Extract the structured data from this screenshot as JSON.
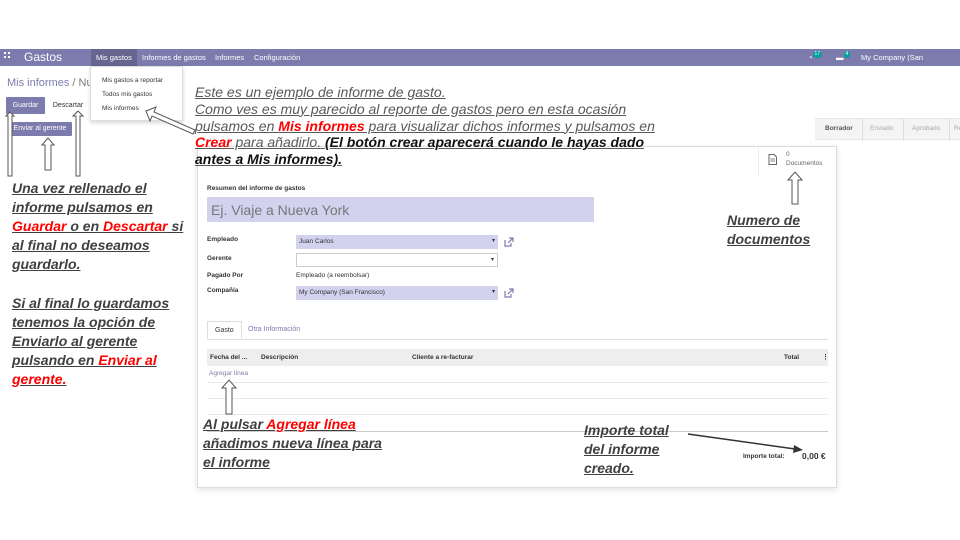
{
  "navbar": {
    "brand": "Gastos",
    "menus": [
      "Mis gastos",
      "Informes de gastos",
      "Informes",
      "Configuración"
    ],
    "activity_count": "17",
    "message_count": "4",
    "company": "My Company (San Francisco)"
  },
  "dropdown": {
    "items": [
      "Mis gastos a reportar",
      "Todos mis gastos",
      "Mis informes"
    ]
  },
  "breadcrumb": {
    "parent": "Mis informes",
    "separator": " / ",
    "current": "Nue"
  },
  "buttons": {
    "save": "Guardar",
    "discard": "Descartar",
    "send_manager": "Enviar al gerente"
  },
  "statusbar": {
    "stages": [
      "Borrador",
      "Enviado",
      "Aprobado",
      "Re"
    ]
  },
  "sheet": {
    "docs_count": "0",
    "docs_label": "Documentos",
    "summary_label": "Resumen del informe de gastos",
    "title_placeholder": "Ej. Viaje a Nueva York",
    "employee_label": "Empleado",
    "employee_value": "Juan Carlos",
    "manager_label": "Gerente",
    "manager_value": "",
    "paid_by_label": "Pagado Por",
    "paid_by_value": "Empleado (a reembolsar)",
    "company_label": "Compañía",
    "company_value": "My Company (San Francisco)",
    "tabs": [
      "Gasto",
      "Otra Información"
    ],
    "columns": [
      "Fecha del ...",
      "Descripción",
      "Cliente a re-facturar",
      "Total"
    ],
    "add_line": "Agregar línea",
    "total_label": "Importe total:",
    "total_value": "0,00 €"
  },
  "annotations": {
    "intro_line1": "Este es un ejemplo de informe de gasto.",
    "intro_line2": "Como ves es muy parecido al reporte de gastos pero en esta ocasión",
    "intro_line3a": "pulsamos en ",
    "intro_line3b": "Mis informes",
    "intro_line3c": " para  visualizar dichos informes y pulsamos en",
    "intro_line4a": "Crear",
    "intro_line4b": " para añadirlo. ",
    "intro_line4c": "(El botón crear aparecerá cuando le hayas dado",
    "intro_line5": "antes a Mis informes).",
    "left_p1a": "Una vez rellenado el informe pulsamos en ",
    "left_p1b": "Guardar",
    "left_p1c": " o en ",
    "left_p1d": "Descartar",
    "left_p1e": " si al final no deseamos guardarlo.",
    "left_p2a": "Si al final lo guardamos tenemos la opción de Enviarlo al gerente pulsando en ",
    "left_p2b": "Enviar al gerente.",
    "docs_note": "Numero de documentos",
    "addline_a": "Al pulsar ",
    "addline_b": "Agregar línea",
    "addline_c": " añadimos  nueva línea para el informe",
    "total_note": "Importe total del informe creado."
  }
}
